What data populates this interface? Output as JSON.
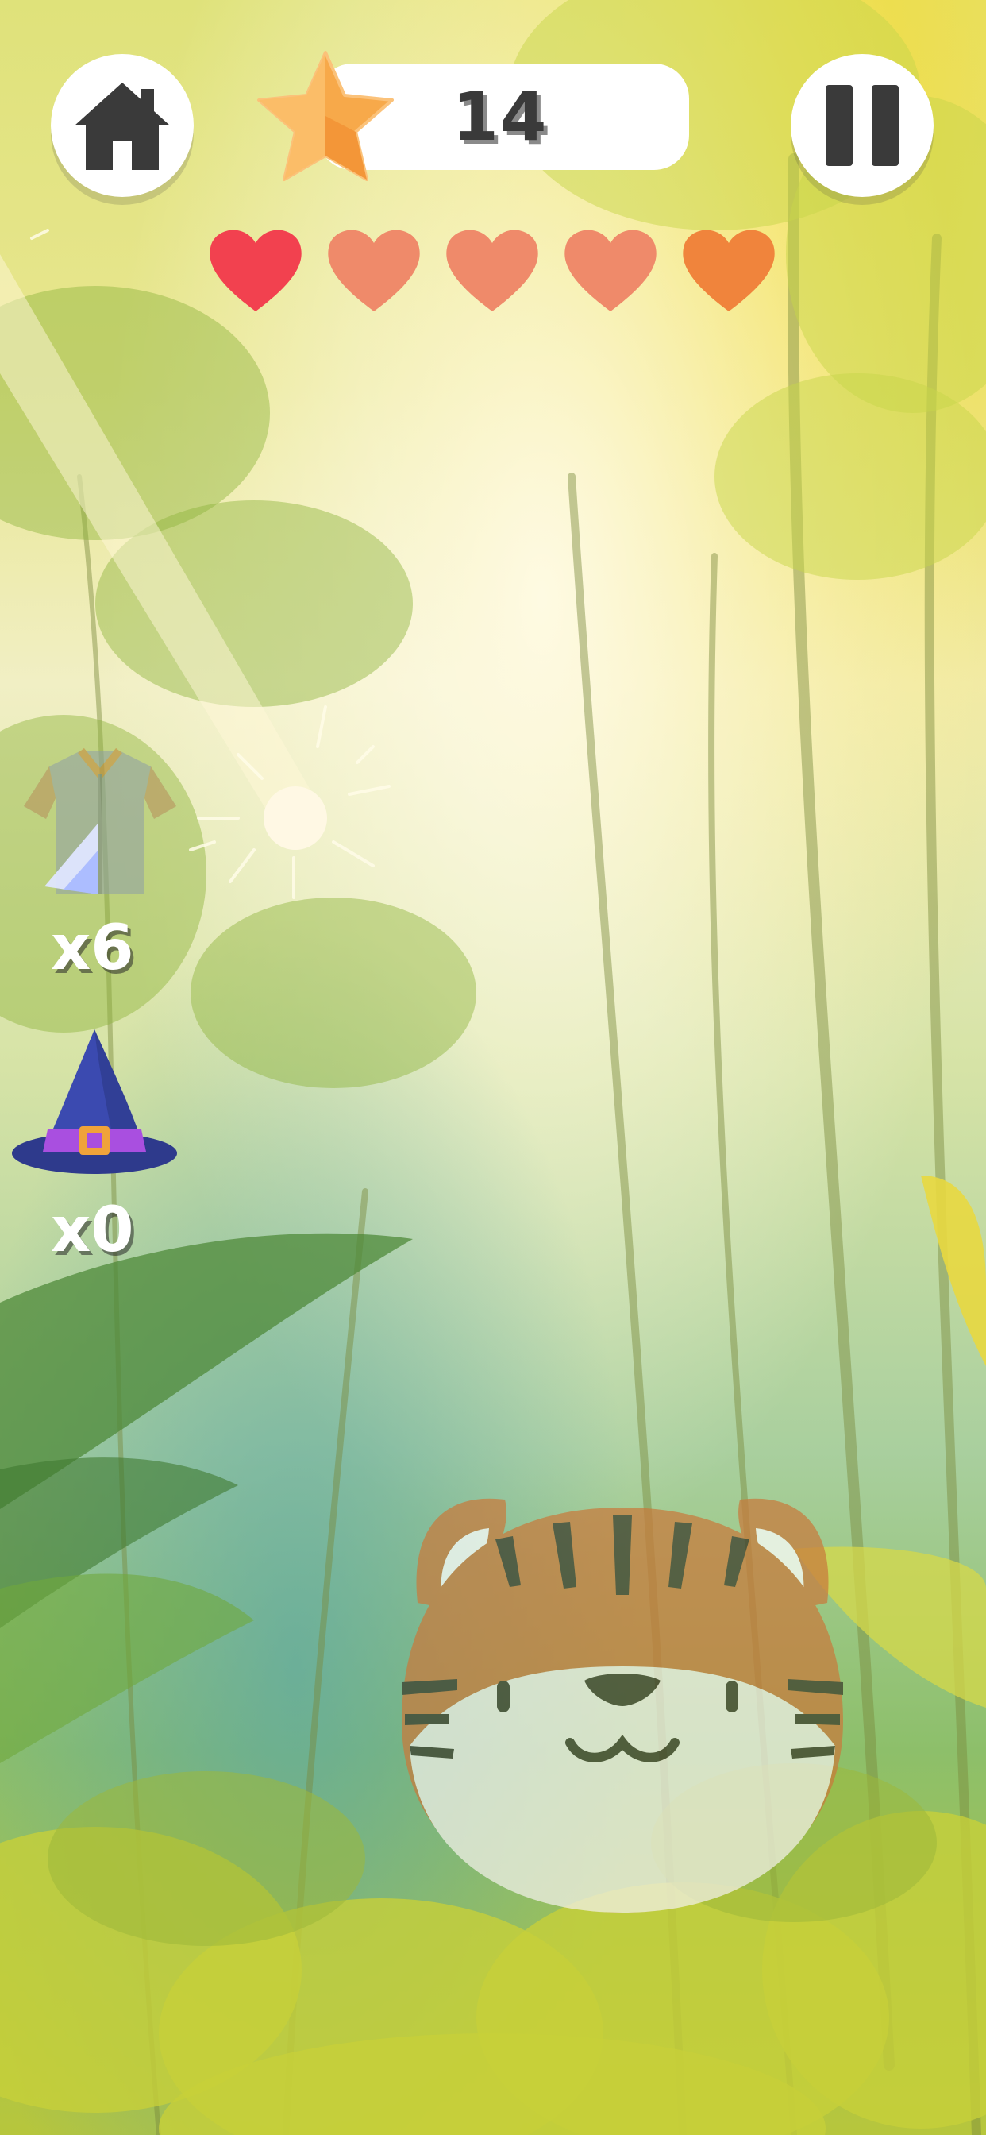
{
  "hud": {
    "score": "14",
    "lives_total": 5,
    "lives_remaining": 5,
    "heart_colors": [
      "#f2414f",
      "#ef8a6a",
      "#ef8a6a",
      "#ef8a6a",
      "#f0843c"
    ]
  },
  "powerups": {
    "armor": {
      "icon": "armor-icon",
      "count_label": "x6"
    },
    "wizard_hat": {
      "icon": "wizard-hat-icon",
      "count_label": "x0"
    }
  },
  "colors": {
    "button_bg": "#ffffff",
    "icon_dark": "#3a3a3a",
    "star": "#f7a94a"
  }
}
